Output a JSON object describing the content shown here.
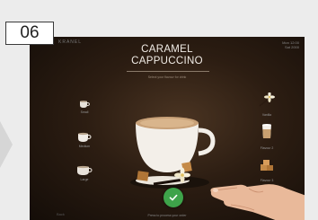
{
  "step": {
    "number": "06"
  },
  "screen": {
    "brand": "KRANEL",
    "status": {
      "line1": "Mon 12:00",
      "line2": "Sat 2000"
    },
    "title_line1": "CARAMEL",
    "title_line2": "CAPPUCCINO",
    "subtitle": "Select your flavour for drink",
    "sizes": [
      {
        "label": "Small",
        "icon": "small-cup-icon"
      },
      {
        "label": "Medium",
        "icon": "medium-cup-icon"
      },
      {
        "label": "Large",
        "icon": "large-cup-icon"
      }
    ],
    "flavors": [
      {
        "label": "Vanilla",
        "icon": "vanilla-flower-icon"
      },
      {
        "label": "Flavour 2",
        "icon": "milk-glass-icon"
      },
      {
        "label": "Flavour 3",
        "icon": "caramel-cubes-icon"
      }
    ],
    "hint": "Press to process your order",
    "bottom_left": "Back"
  },
  "colors": {
    "confirm": "#3ea34a",
    "background": "#2c1d12",
    "title": "#f1ece6"
  }
}
